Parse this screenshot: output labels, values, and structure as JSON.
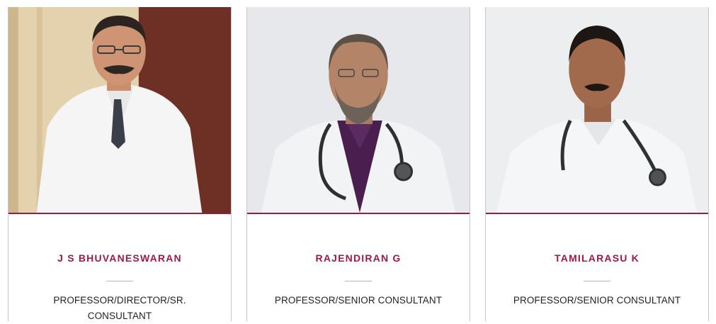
{
  "doctors": [
    {
      "name": "J S BHUVANESWARAN",
      "title": "PROFESSOR/DIRECTOR/SR. CONSULTANT"
    },
    {
      "name": "RAJENDIRAN G",
      "title": "PROFESSOR/SENIOR CONSULTANT"
    },
    {
      "name": "TAMILARASU K",
      "title": "PROFESSOR/SENIOR CONSULTANT"
    }
  ],
  "colors": {
    "accent": "#9c1a4a",
    "divider": "#b7b7b7"
  }
}
